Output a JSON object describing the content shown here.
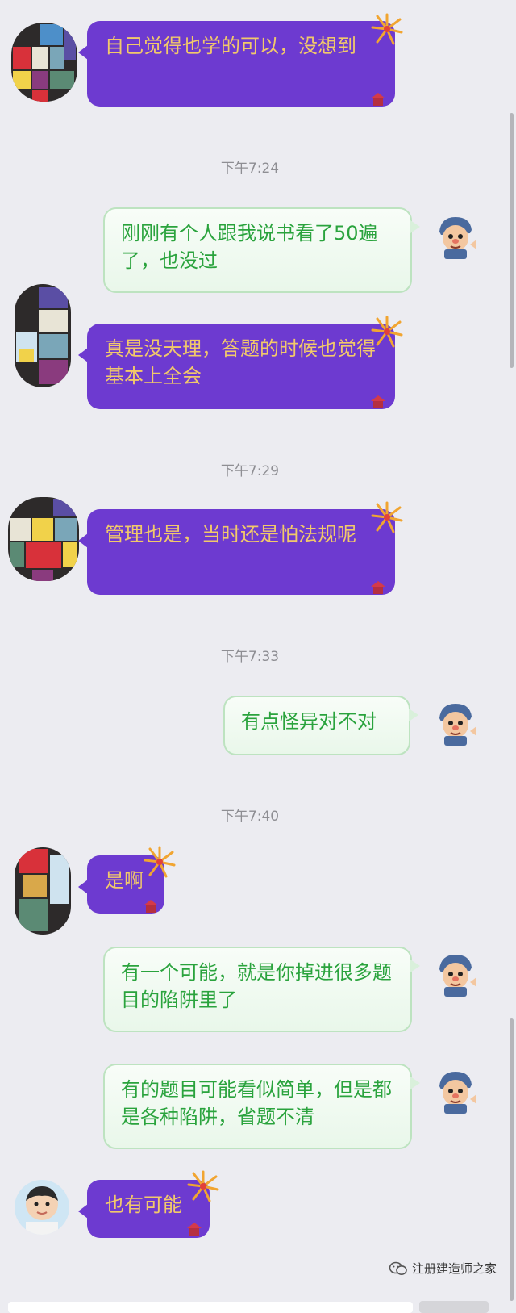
{
  "messages": [
    {
      "side": "left",
      "text": "自己觉得也学的可以，没想到"
    },
    {
      "time": "下午7:24"
    },
    {
      "side": "right",
      "text": "刚刚有个人跟我说书看了50遍了，也没过"
    },
    {
      "side": "left",
      "text": "真是没天理，答题的时候也觉得基本上全会"
    },
    {
      "time": "下午7:29"
    },
    {
      "side": "left",
      "text": "管理也是，当时还是怕法规呢"
    },
    {
      "time": "下午7:33"
    },
    {
      "side": "right",
      "text": "有点怪异对不对"
    },
    {
      "time": "下午7:40"
    },
    {
      "side": "left",
      "text": "是啊"
    },
    {
      "side": "right",
      "text": "有一个可能，就是你掉进很多题目的陷阱里了"
    },
    {
      "side": "right",
      "text": "有的题目可能看似简单，但是都是各种陷阱，省题不清"
    },
    {
      "side": "left",
      "text": "也有可能"
    }
  ],
  "watermark": {
    "text": "注册建造师之家"
  },
  "colors": {
    "left_bubble": "#6d3ad0",
    "left_text": "#f2c96a",
    "right_text": "#2aa33d",
    "background": "#ececf1"
  }
}
